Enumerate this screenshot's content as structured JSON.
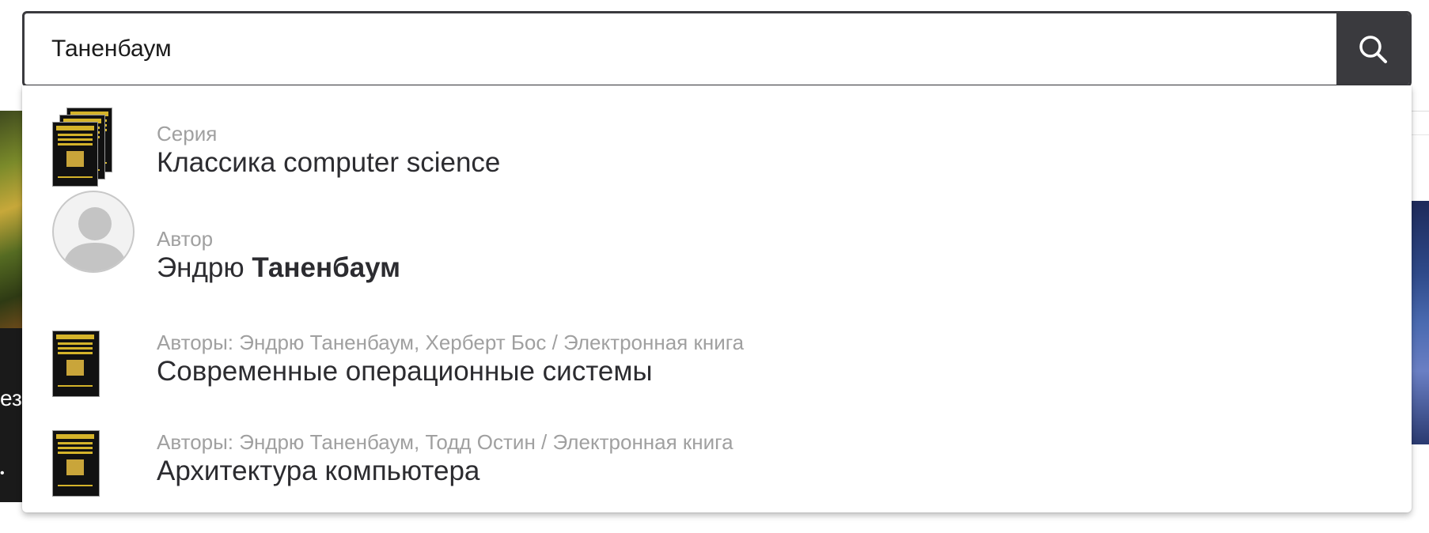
{
  "search": {
    "query": "Таненбаум",
    "placeholder": "",
    "button_icon": "search-icon"
  },
  "colors": {
    "search_border": "#3a3a3e",
    "search_button_bg": "#3a3a3e",
    "label_gray": "#a0a0a0",
    "title_dark": "#2c2c30",
    "book_gold": "#d4b32a"
  },
  "suggestions": [
    {
      "kind": "series",
      "label": "Серия",
      "title": "Классика computer science",
      "thumb": "book-stack-thumbnail"
    },
    {
      "kind": "author",
      "label": "Автор",
      "title_prefix": "Эндрю ",
      "title_bold": "Таненбаум",
      "thumb": "user-avatar-icon"
    },
    {
      "kind": "book",
      "label": "Авторы: Эндрю Таненбаум, Херберт Бос / Электронная книга",
      "title": "Современные операционные системы",
      "thumb": "book-cover-thumbnail"
    },
    {
      "kind": "book",
      "label": "Авторы: Эндрю Таненбаум, Тодд Остин / Электронная книга",
      "title": "Архитектура компьютера",
      "thumb": "book-cover-thumbnail"
    }
  ],
  "background": {
    "left_text": "ез",
    "left_dot": "•"
  }
}
